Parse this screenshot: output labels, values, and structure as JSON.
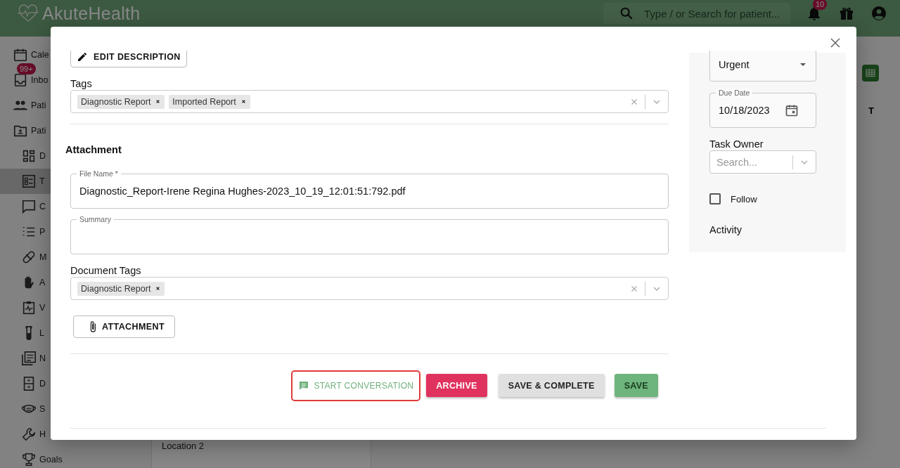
{
  "header": {
    "logo": "AkuteHealth",
    "search_placeholder": "Type / or Search for patient...",
    "notification_count": "10"
  },
  "sidebar": {
    "items": [
      {
        "label": "Cale",
        "selected": false
      },
      {
        "label": "Inbo",
        "selected": false,
        "badge": "99+"
      },
      {
        "label": "Pati",
        "selected": false
      },
      {
        "label": "Pati",
        "selected": false,
        "children": [
          {
            "label": "D",
            "selected": false
          },
          {
            "label": "T",
            "selected": true
          },
          {
            "label": "C",
            "selected": false
          },
          {
            "label": "P",
            "selected": false
          },
          {
            "label": "M",
            "selected": false
          },
          {
            "label": "A",
            "selected": false
          },
          {
            "label": "V",
            "selected": false
          },
          {
            "label": "L",
            "selected": false
          },
          {
            "label": "N",
            "selected": false
          },
          {
            "label": "D",
            "selected": false
          },
          {
            "label": "S",
            "selected": false
          },
          {
            "label": "H",
            "selected": false
          },
          {
            "label": "Goals",
            "selected": false
          }
        ]
      }
    ]
  },
  "background": {
    "location_text": "Location 2",
    "column_header": "T"
  },
  "modal": {
    "edit_description_button": "EDIT DESCRIPTION",
    "tags": {
      "label": "Tags",
      "chips": [
        "Diagnostic Report",
        "Imported Report"
      ]
    },
    "attachment_heading": "Attachment",
    "file_name": {
      "label": "File Name *",
      "value": "Diagnostic_Report-Irene Regina Hughes-2023_10_19_12:01:51:792.pdf"
    },
    "summary": {
      "label": "Summary"
    },
    "document_tags": {
      "label": "Document Tags",
      "chips": [
        "Diagnostic Report"
      ]
    },
    "attachment_button": "ATTACHMENT",
    "actions": [
      {
        "label": "START CONVERSATION",
        "kind": "text",
        "highlighted": true
      },
      {
        "label": "ARCHIVE",
        "kind": "danger",
        "highlighted": false
      },
      {
        "label": "SAVE & COMPLETE",
        "kind": "default",
        "highlighted": false
      },
      {
        "label": "SAVE",
        "kind": "primary",
        "highlighted": false
      }
    ],
    "side_panel": {
      "priority": {
        "value": "Urgent"
      },
      "due_date": {
        "label": "Due Date",
        "value": "10/18/2023"
      },
      "task_owner": {
        "label": "Task Owner",
        "placeholder": "Search..."
      },
      "follow": {
        "label": "Follow",
        "checked": false
      },
      "activity_heading": "Activity"
    }
  }
}
